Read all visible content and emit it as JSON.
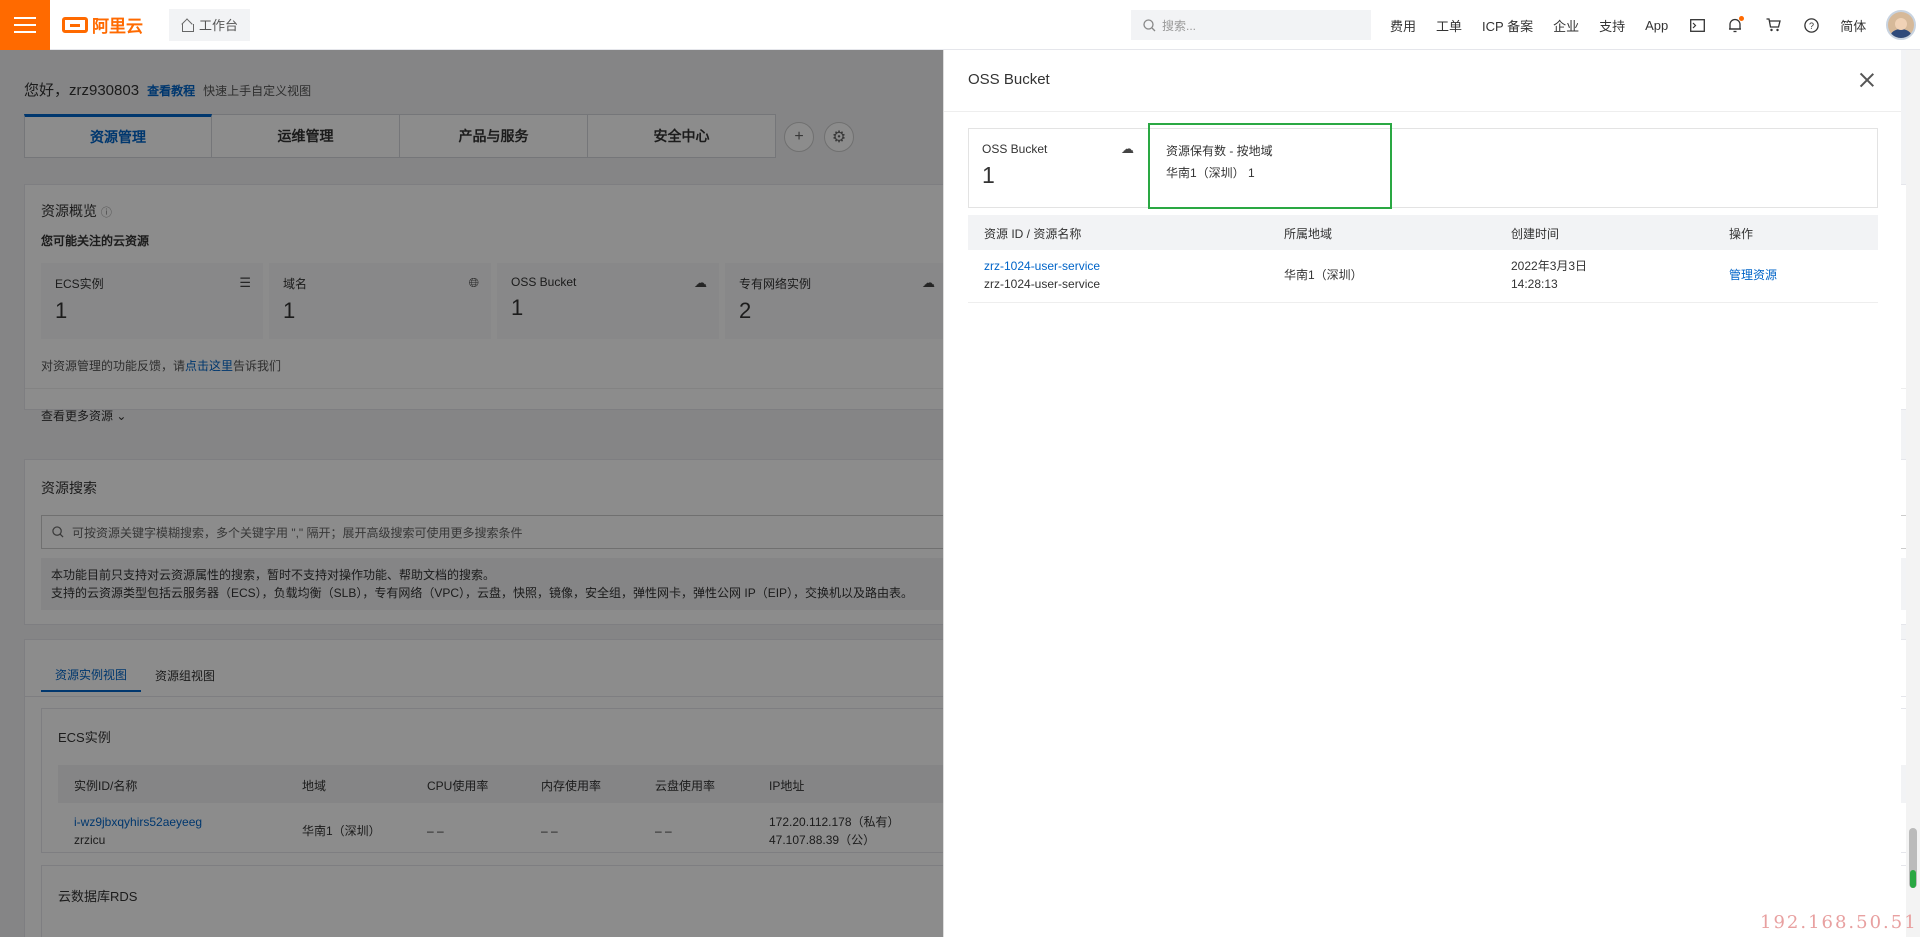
{
  "topbar": {
    "brand": "阿里云",
    "workbench": "工作台",
    "search_placeholder": "搜索...",
    "links": [
      "费用",
      "工单",
      "ICP 备案",
      "企业",
      "支持",
      "App"
    ],
    "lang": "简体"
  },
  "greeting": {
    "hello": "您好，zrz930803",
    "tutorial_link": "查看教程",
    "desc": "快速上手自定义视图"
  },
  "tabs": [
    "资源管理",
    "运维管理",
    "产品与服务",
    "安全中心"
  ],
  "overview": {
    "title": "资源概览",
    "subtitle": "您可能关注的云资源",
    "tiles": [
      {
        "name": "ECS实例",
        "count": "1",
        "icon": "server-icon"
      },
      {
        "name": "域名",
        "count": "1",
        "icon": "globe-icon"
      },
      {
        "name": "OSS Bucket",
        "count": "1",
        "icon": "cloud-upload-icon"
      },
      {
        "name": "专有网络实例",
        "count": "2",
        "icon": "cloud-network-icon"
      }
    ],
    "feedback_prefix": "对资源管理的功能反馈，请",
    "feedback_link": "点击这里",
    "feedback_suffix": "告诉我们",
    "more": "查看更多资源"
  },
  "search": {
    "title": "资源搜索",
    "placeholder": "可按资源关键字模糊搜索，多个关键字用 \",\" 隔开；展开高级搜索可使用更多搜索条件",
    "note_line1": "本功能目前只支持对云资源属性的搜索，暂时不支持对操作功能、帮助文档的搜索。",
    "note_line2": "支持的云资源类型包括云服务器（ECS），负载均衡（SLB），专有网络（VPC），云盘，快照，镜像，安全组，弹性网卡，弹性公网 IP（EIP），交换机以及路由表。"
  },
  "instance_view": {
    "tabs": [
      "资源实例视图",
      "资源组视图"
    ],
    "ecs_title": "ECS实例",
    "columns": [
      "实例ID/名称",
      "地域",
      "CPU使用率",
      "内存使用率",
      "云盘使用率",
      "IP地址"
    ],
    "row": {
      "id": "i-wz9jbxqyhirs52aeyeeg",
      "name": "zrzicu",
      "region": "华南1（深圳）",
      "cpu": "– –",
      "mem": "– –",
      "disk": "– –",
      "ip_private": "172.20.112.178（私有）",
      "ip_public": "47.107.88.39（公）"
    },
    "rds_title": "云数据库RDS"
  },
  "drawer": {
    "title": "OSS Bucket",
    "stat_label": "OSS Bucket",
    "stat_count": "1",
    "region_label": "资源保有数 - 按地域",
    "region_value": "华南1（深圳） 1",
    "columns": [
      "资源 ID / 资源名称",
      "所属地域",
      "创建时间",
      "操作"
    ],
    "row": {
      "id": "zrz-1024-user-service",
      "name": "zrz-1024-user-service",
      "region": "华南1（深圳）",
      "date": "2022年3月3日",
      "time": "14:28:13",
      "action": "管理资源"
    }
  },
  "watermark": "192.168.50.51",
  "colors": {
    "brand": "#ff6a00",
    "link": "#0064c8",
    "highlight": "#2aa843"
  }
}
